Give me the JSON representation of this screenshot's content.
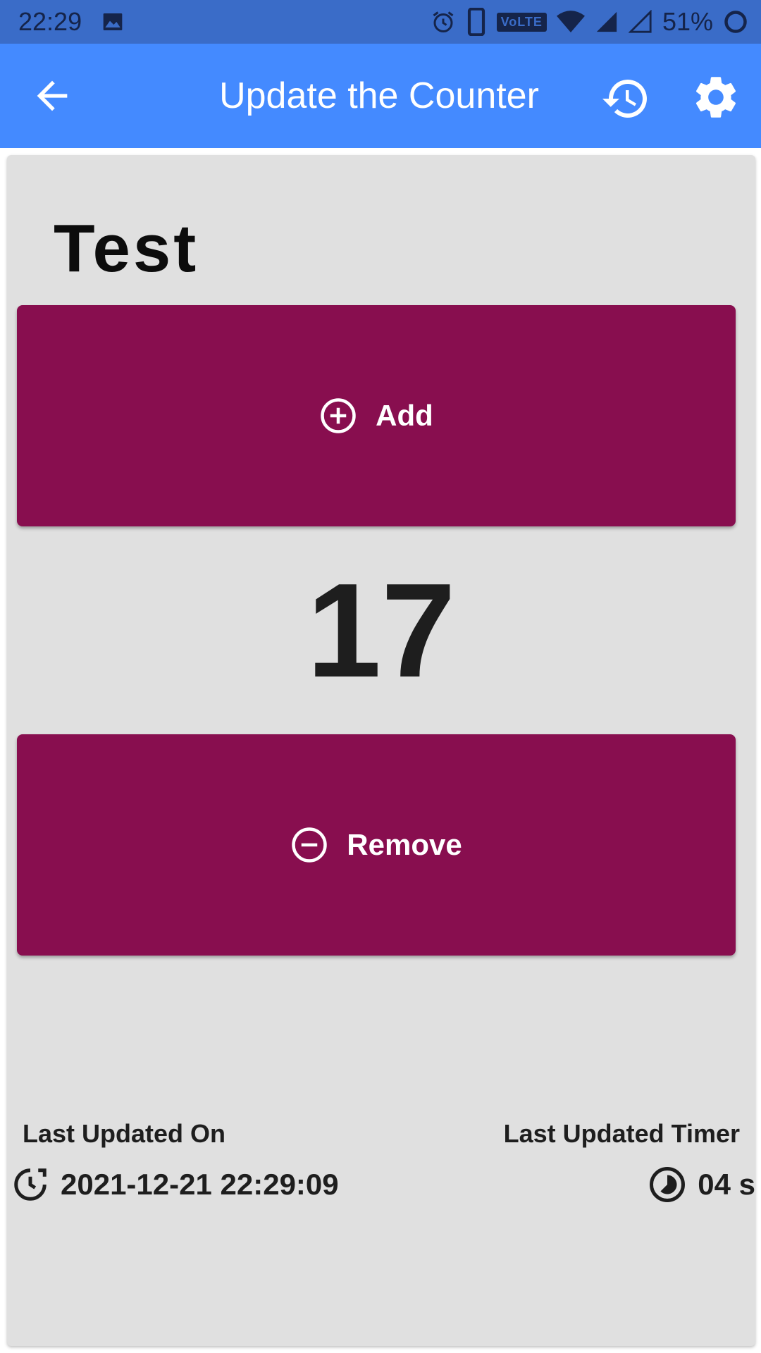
{
  "status_bar": {
    "time": "22:29",
    "network_badge": "VoLTE",
    "battery": "51%"
  },
  "app_bar": {
    "title": "Update the Counter"
  },
  "counter": {
    "name": "Test",
    "value": "17",
    "add_label": "Add",
    "remove_label": "Remove"
  },
  "footer": {
    "last_updated_on_label": "Last Updated On",
    "last_updated_on_value": "2021-12-21 22:29:09",
    "last_updated_timer_label": "Last Updated Timer",
    "last_updated_timer_value": "04 s"
  },
  "colors": {
    "status_bar": "#3a6cc8",
    "app_bar": "#448aff",
    "button": "#880e4f",
    "card": "#e0e0e0"
  }
}
